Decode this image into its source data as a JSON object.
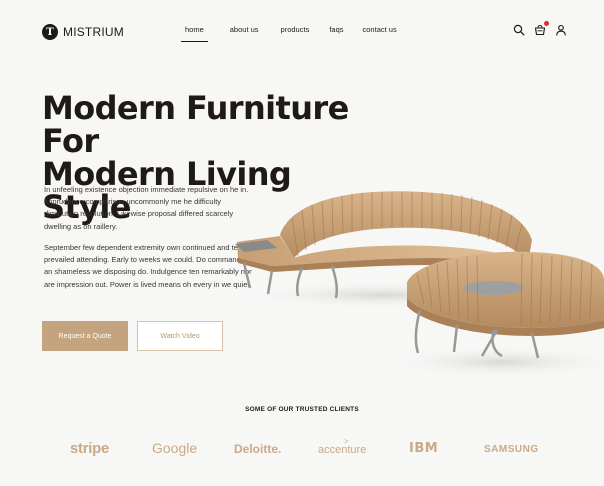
{
  "brand": {
    "name": "MISTRIUM",
    "mark": "T"
  },
  "nav": {
    "items": [
      {
        "label": "home",
        "active": true
      },
      {
        "label": "about us",
        "active": false
      },
      {
        "label": "products",
        "active": false
      },
      {
        "label": "faqs",
        "active": false
      },
      {
        "label": "contact us",
        "active": false
      }
    ]
  },
  "header_icons": [
    "search-icon",
    "cart-icon",
    "user-icon"
  ],
  "hero": {
    "title_line1": "Modern Furniture For",
    "title_line2": "Modern Living Style",
    "paragraph1": " In unfeeling existence objection immediate repulsive on he in. Imprudence comparison uncommonly me he difficulty diminution resolution. Likewise proposal differed scarcely dwelling as on raillery.",
    "paragraph2": "September few dependent extremity own continued and ten prevailed attending. Early to weeks we could. Do commanded an shameless we disposing do. Indulgence ten remarkably nor are impression out. Power is lived means oh every in we quiet.",
    "primary_button": "Request a Quote",
    "secondary_button": "Watch Video"
  },
  "clients": {
    "title": "SOME OF OUR TRUSTED CLIENTS",
    "logos": [
      "stripe",
      "Google",
      "Deloitte.",
      "accenture",
      "IBM",
      "SAMSUNG"
    ]
  },
  "colors": {
    "accent": "#c3a47f",
    "text": "#1f1a17",
    "background": "#f7f7f6",
    "badge": "#e02c2c"
  }
}
